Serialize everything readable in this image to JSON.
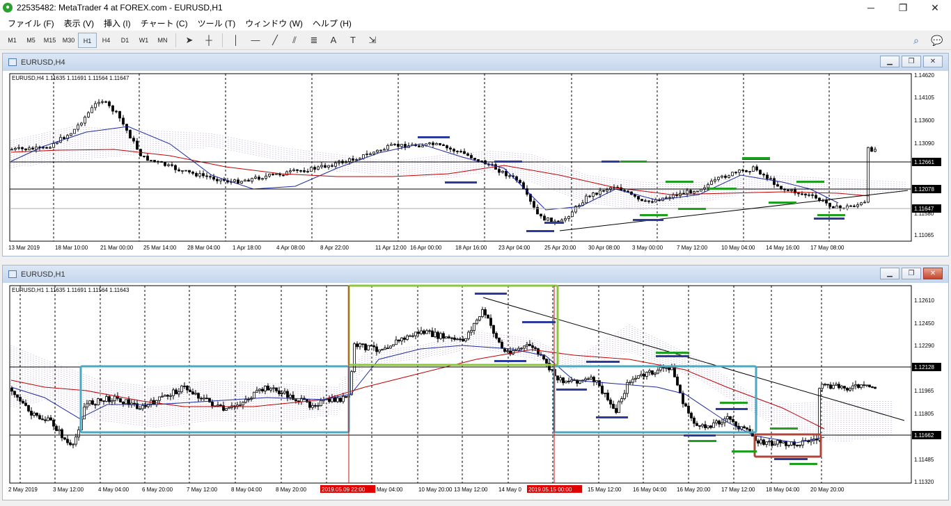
{
  "app": {
    "title": "22535482: MetaTrader 4 at FOREX.com - EURUSD,H1"
  },
  "menu": [
    "ファイル (F)",
    "表示 (V)",
    "挿入 (I)",
    "チャート (C)",
    "ツール (T)",
    "ウィンドウ (W)",
    "ヘルプ (H)"
  ],
  "toolbar": {
    "timeframes": [
      "M1",
      "M5",
      "M15",
      "M30",
      "H1",
      "H4",
      "D1",
      "W1",
      "MN"
    ],
    "active_timeframe": "H1",
    "tools": [
      {
        "name": "cursor-tool",
        "glyph": "➤"
      },
      {
        "name": "crosshair-tool",
        "glyph": "┼"
      },
      {
        "name": "vertical-line-tool",
        "glyph": "│"
      },
      {
        "name": "horizontal-line-tool",
        "glyph": "—"
      },
      {
        "name": "trendline-tool",
        "glyph": "╱"
      },
      {
        "name": "equidistant-channel-tool",
        "glyph": "⫽"
      },
      {
        "name": "fibonacci-tool",
        "glyph": "≣"
      },
      {
        "name": "text-tool",
        "glyph": "A"
      },
      {
        "name": "text-label-tool",
        "glyph": "T"
      },
      {
        "name": "arrows-tool",
        "glyph": "⇲"
      }
    ]
  },
  "chart_top": {
    "window_title": "EURUSD,H4",
    "info_line": "EURUSD,H4  1.11635 1.11691 1.11564 1.11647",
    "price_labels": [
      "1.14620",
      "1.14105",
      "1.13600",
      "1.13090",
      "1.12661",
      "1.12078",
      "1.11647",
      "1.11580",
      "1.11065"
    ],
    "highlight_prices": [
      {
        "label": "1.12661",
        "bg": "#000000",
        "fg": "#ffffff"
      },
      {
        "label": "1.12078",
        "bg": "#000000",
        "fg": "#ffffff"
      },
      {
        "label": "1.11647",
        "bg": "#000000",
        "fg": "#ffffff"
      }
    ],
    "time_labels": [
      "13 Mar 2019",
      "18 Mar 10:00",
      "21 Mar 00:00",
      "25 Mar 14:00",
      "28 Mar 04:00",
      "1 Apr 18:00",
      "4 Apr 08:00",
      "8 Apr 22:00",
      "11 Apr 12:00",
      "16 Apr 00:00",
      "18 Apr 16:00",
      "23 Apr 04:00",
      "25 Apr 20:00",
      "30 Apr 08:00",
      "3 May 00:00",
      "7 May 12:00",
      "10 May 04:00",
      "14 May 16:00",
      "17 May 08:00"
    ]
  },
  "chart_bottom": {
    "window_title": "EURUSD,H1",
    "info_line": "EURUSD,H1  1.11635 1.11691 1.11564 1.11643",
    "price_labels": [
      "1.12610",
      "1.12450",
      "1.12290",
      "1.12128",
      "1.11965",
      "1.11805",
      "1.11662",
      "1.11485",
      "1.11320"
    ],
    "highlight_prices": [
      {
        "label": "1.12128",
        "bg": "#000000",
        "fg": "#ffffff"
      },
      {
        "label": "1.11662",
        "bg": "#000000",
        "fg": "#ffffff"
      }
    ],
    "time_labels": [
      "2 May 2019",
      "3 May 12:00",
      "4 May 04:00",
      "6 May 20:00",
      "7 May 12:00",
      "8 May 04:00",
      "8 May 20:00",
      "2019.05.09 22:00",
      "May 04:00",
      "10 May 20:00",
      "13 May 12:00",
      "14 May 0",
      "2019.05.15 00:00",
      "15 May 12:00",
      "16 May 04:00",
      "16 May 20:00",
      "17 May 12:00",
      "18 May 04:00",
      "20 May 20:00"
    ],
    "red_time_labels": [
      "2019.05.09 22:00",
      "2019.05.15 00:00"
    ]
  },
  "colors": {
    "accent_blue": "#2b3a9e",
    "accent_green": "#1ea01e",
    "box_cyan": "#4aa8c0",
    "box_lime": "#8cc63f",
    "box_red": "#b0453a",
    "ma_red": "#c00000",
    "ma_blue": "#1c2a9e",
    "cloud_orange": "#e0903c",
    "cloud_violet": "#b9a8d8",
    "vline_red": "#d01010"
  }
}
